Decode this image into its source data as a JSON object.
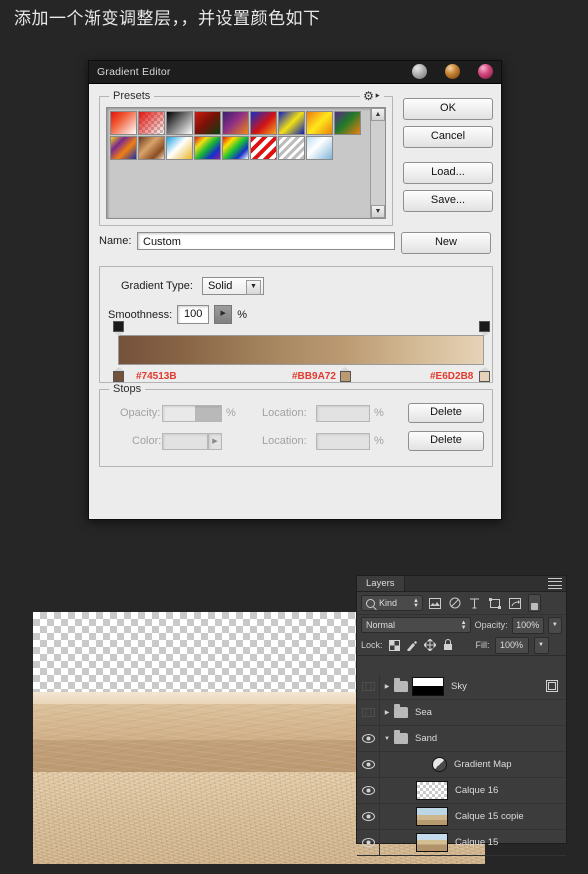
{
  "caption": "添加一个渐变调整层，，并设置颜色如下",
  "dialog": {
    "title": "Gradient Editor",
    "window_buttons": [
      "minimize-sphere",
      "maximize-sphere",
      "close-sphere"
    ],
    "presets": {
      "legend": "Presets",
      "gear_icon": "gear-icon",
      "swatches": [
        {
          "name": "red-to-white",
          "css": "linear-gradient(135deg,#e2150f 0%,#f05a33 35%,#ffffff 100%)"
        },
        {
          "name": "red-to-transparent",
          "css": "linear-gradient(135deg,#e2150f 0%,rgba(226,21,15,0) 100%)",
          "checker": true
        },
        {
          "name": "black-to-white",
          "css": "linear-gradient(135deg,#000000 0%,#ffffff 100%)"
        },
        {
          "name": "red-green-dark",
          "css": "linear-gradient(135deg,#cf1b10 0%,#7d1008 45%,#0e3d10 100%)"
        },
        {
          "name": "violet-orange",
          "css": "linear-gradient(135deg,#3a1f6e 0%,#8e2f86 45%,#f08a12 100%)"
        },
        {
          "name": "blue-red-yellow",
          "css": "linear-gradient(135deg,#1530c8 0%,#d11414 55%,#f5a623 100%)"
        },
        {
          "name": "blue-yellow-blue",
          "css": "linear-gradient(135deg,#1020c0 0%,#f2e014 50%,#0c1fb5 100%)"
        },
        {
          "name": "orange-yellow-orange",
          "css": "linear-gradient(135deg,#f07a10 0%,#ffe81c 50%,#e87f0c 100%)"
        },
        {
          "name": "violet-green-orange",
          "css": "linear-gradient(135deg,#5d2a86 0%,#1f7a2a 45%,#ef7e10 100%)"
        },
        {
          "name": "yellow-violet-orange-blue",
          "css": "linear-gradient(135deg,#f4d013 0%,#7a2a8f 30%,#ef8010 60%,#1b2fb0 100%)"
        },
        {
          "name": "copper",
          "css": "linear-gradient(135deg,#6b3a1c 0%,#d9a36c 40%,#8a4c22 75%,#f2dcc4 100%)"
        },
        {
          "name": "blue-yellow-chrome",
          "css": "linear-gradient(135deg,#1a9fe0 0%,#ffffff 45%,#e8b428 100%)"
        },
        {
          "name": "spectrum",
          "css": "linear-gradient(135deg,#e01010 0%,#f2e014 25%,#18b832 50%,#1530c8 75%,#8e1fa8 100%)"
        },
        {
          "name": "transparent-rainbow",
          "css": "linear-gradient(135deg,#e01010 0%,#ffe000 25%,#19c235 50%,#1530c8 75%,#ffffff 100%)",
          "checker": true
        },
        {
          "name": "red-stripes",
          "css": "repeating-linear-gradient(135deg,#e01010 0 4px,#ffffff 4px 8px)"
        },
        {
          "name": "transparent-stripes",
          "css": "repeating-linear-gradient(135deg,#bdbdbd 0 3px,#ffffff 3px 6px)",
          "checker": true
        },
        {
          "name": "blue-white-chrome",
          "css": "linear-gradient(135deg,#bcdcf0 0%,#ffffff 40%,#7fb6d8 100%)"
        }
      ]
    },
    "buttons": {
      "ok": "OK",
      "cancel": "Cancel",
      "load": "Load...",
      "save": "Save..."
    },
    "name_label": "Name:",
    "name_value": "Custom",
    "new_button": "New",
    "gradient_type_label": "Gradient Type:",
    "gradient_type_value": "Solid",
    "smoothness_label": "Smoothness:",
    "smoothness_value": "100",
    "percent": "%",
    "gradient_bar": {
      "css": "linear-gradient(90deg,#74513b 0%,#8b6747 20%,#a98a63 45%,#bb9a72 62%,#d4bb96 82%,#e6d2b8 100%)",
      "opacity_stops": [
        {
          "name": "opacity-stop-left",
          "position_pct": 0
        },
        {
          "name": "opacity-stop-right",
          "position_pct": 100
        }
      ],
      "color_stops": [
        {
          "name": "color-stop-left",
          "hex": "#74513B",
          "position_pct": 0
        },
        {
          "name": "color-stop-middle",
          "hex": "#BB9A72",
          "position_pct": 62
        },
        {
          "name": "color-stop-right",
          "hex": "#E6D2B8",
          "position_pct": 100
        }
      ]
    },
    "stops": {
      "legend": "Stops",
      "opacity_label": "Opacity:",
      "opacity_value": "",
      "color_label": "Color:",
      "color_value": "",
      "location_label": "Location:",
      "location_value_1": "",
      "location_value_2": "",
      "delete_1": "Delete",
      "delete_2": "Delete"
    }
  },
  "layers_panel": {
    "tab": "Layers",
    "menu_icon": "panel-menu-icon",
    "filter": {
      "kind_label": "Kind",
      "search_icon": "search-icon",
      "icons": [
        "pixel-layer-filter-icon",
        "adjustment-layer-filter-icon",
        "type-layer-filter-icon",
        "shape-layer-filter-icon",
        "smart-object-filter-icon"
      ],
      "toggle": "filter-toggle-switch"
    },
    "blend_mode": "Normal",
    "opacity_label": "Opacity:",
    "opacity_value": "100%",
    "lock_label": "Lock:",
    "lock_icons": [
      "lock-transparent-pixels-icon",
      "lock-image-pixels-icon",
      "lock-position-icon",
      "lock-all-icon"
    ],
    "fill_label": "Fill:",
    "fill_value": "100%",
    "rows": [
      {
        "name": "Sky",
        "type": "group",
        "visible": false,
        "expanded": false,
        "thumb": "mask",
        "has_link": true
      },
      {
        "name": "Sea",
        "type": "group",
        "visible": false,
        "expanded": false,
        "thumb": "none",
        "has_link": false
      },
      {
        "name": "Sand",
        "type": "group",
        "visible": true,
        "expanded": true,
        "thumb": "none",
        "has_link": false
      },
      {
        "name": "Gradient Map",
        "type": "adjustment",
        "visible": true,
        "expanded": false,
        "thumb": "adjustment",
        "has_link": false
      },
      {
        "name": "Calque 16",
        "type": "pixel",
        "visible": true,
        "expanded": false,
        "thumb": "checker",
        "has_link": false
      },
      {
        "name": "Calque 15 copie",
        "type": "pixel",
        "visible": true,
        "expanded": false,
        "thumb": "photo",
        "has_link": false
      },
      {
        "name": "Calque 15",
        "type": "pixel",
        "visible": true,
        "expanded": false,
        "thumb": "photo2",
        "has_link": false
      }
    ]
  },
  "canvas": {
    "name": "document-canvas",
    "description": "desert sand photograph with transparent sky area"
  }
}
